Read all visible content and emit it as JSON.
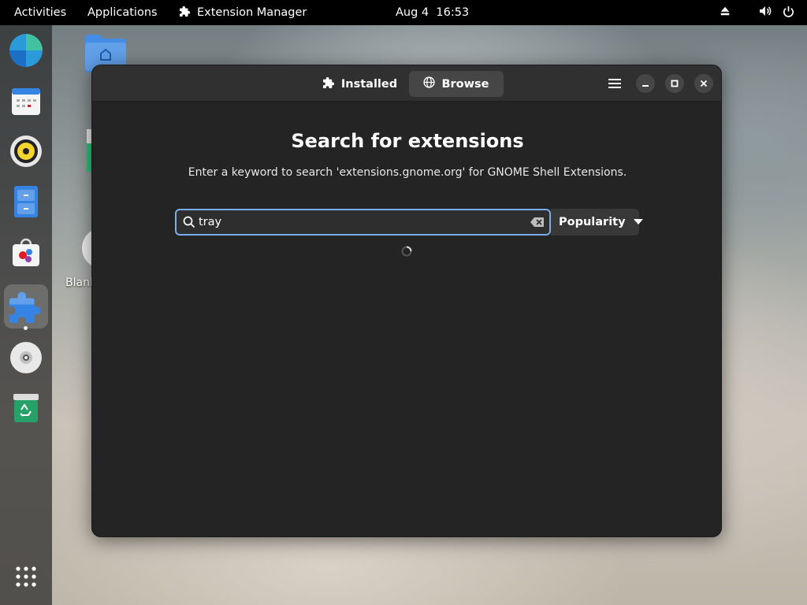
{
  "topbar": {
    "activities": "Activities",
    "applications": "Applications",
    "app_name": "Extension Manager",
    "clock": "Aug 4  16:53"
  },
  "desktop": {
    "icon_label": "Blank"
  },
  "window": {
    "tabs": [
      {
        "label": "Installed",
        "icon": "puzzle-icon",
        "selected": false
      },
      {
        "label": "Browse",
        "icon": "globe-icon",
        "selected": true
      }
    ],
    "title": "Search for extensions",
    "subtitle": "Enter a keyword to search 'extensions.gnome.org' for GNOME Shell Extensions.",
    "search": {
      "value": "tray",
      "placeholder": ""
    },
    "sort": {
      "selected": "Popularity"
    }
  },
  "colors": {
    "accent": "#78aeed",
    "window_bg": "#242424",
    "headerbar_bg": "#303030"
  }
}
